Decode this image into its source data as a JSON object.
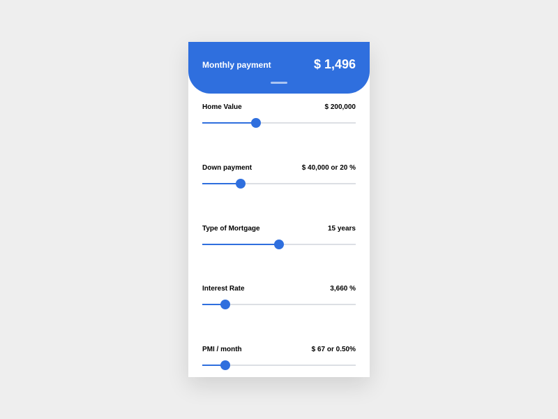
{
  "header": {
    "label": "Monthly payment",
    "value": "$ 1,496"
  },
  "fields": {
    "homeValue": {
      "label": "Home Value",
      "value": "$ 200,000",
      "position": 35
    },
    "downPayment": {
      "label": "Down payment",
      "value": "$ 40,000 or 20 %",
      "position": 25
    },
    "mortgageType": {
      "label": "Type of Mortgage",
      "value": "15 years",
      "position": 50
    },
    "interestRate": {
      "label": "Interest Rate",
      "value": "3,660 %",
      "position": 15
    },
    "pmi": {
      "label": "PMI / month",
      "value": "$ 67 or 0.50%",
      "position": 15
    }
  }
}
